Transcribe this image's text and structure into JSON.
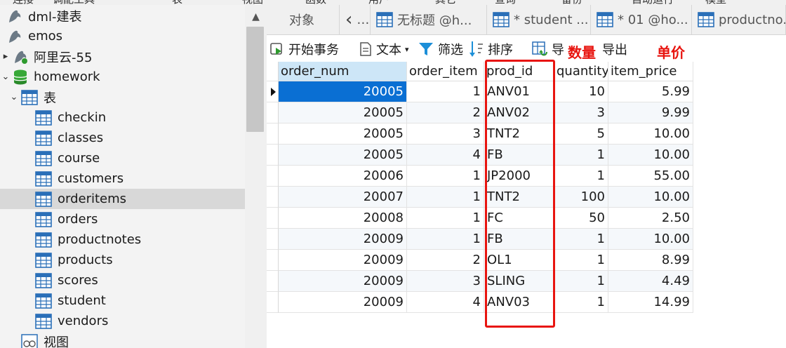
{
  "menu_fragments": [
    "连接",
    "调配工具",
    "表",
    "视图",
    "函数",
    "用户",
    "其它",
    "查询",
    "备份",
    "自动运行",
    "模型"
  ],
  "tree": [
    {
      "label": "dml-建表",
      "icon": "mysql-dolphin-icon",
      "level": 0
    },
    {
      "label": "emos",
      "icon": "mysql-dolphin-icon",
      "level": 0
    },
    {
      "label": "阿里云-55",
      "icon": "mysql-dolphin-green-icon",
      "level": 0,
      "arrow": "▸"
    },
    {
      "label": "homework",
      "icon": "database-icon",
      "level": 1,
      "arrow": "⌄"
    },
    {
      "label": "表",
      "icon": "table-icon",
      "level": 2,
      "arrow": "⌄"
    },
    {
      "label": "checkin",
      "icon": "table-icon",
      "level": 3
    },
    {
      "label": "classes",
      "icon": "table-icon",
      "level": 3
    },
    {
      "label": "course",
      "icon": "table-icon",
      "level": 3
    },
    {
      "label": "customers",
      "icon": "table-icon",
      "level": 3
    },
    {
      "label": "orderitems",
      "icon": "table-icon",
      "level": 3,
      "selected": true
    },
    {
      "label": "orders",
      "icon": "table-icon",
      "level": 3
    },
    {
      "label": "productnotes",
      "icon": "table-icon",
      "level": 3
    },
    {
      "label": "products",
      "icon": "table-icon",
      "level": 3
    },
    {
      "label": "scores",
      "icon": "table-icon",
      "level": 3
    },
    {
      "label": "student",
      "icon": "table-icon",
      "level": 3
    },
    {
      "label": "vendors",
      "icon": "table-icon",
      "level": 3
    },
    {
      "label": "视图",
      "icon": "view-icon",
      "level": 2
    }
  ],
  "tabs": [
    {
      "label": "对象",
      "icon": ""
    },
    {
      "label": "…",
      "icon": "chevron-left-icon"
    },
    {
      "label": "无标题 @h...",
      "icon": "query-icon"
    },
    {
      "label": "* student ...",
      "icon": "query-edit-icon"
    },
    {
      "label": "* 01 @ho...",
      "icon": "table-edit-icon"
    },
    {
      "label": "productno...",
      "icon": "table-icon"
    }
  ],
  "toolbar": {
    "begin_tx": "开始事务",
    "text": "文本",
    "filter": "筛选",
    "sort": "排序",
    "import": "导",
    "export": "导出"
  },
  "annotations": {
    "quantity": "数量",
    "price": "单价"
  },
  "colors": {
    "selection": "#0a6fd3",
    "annotation_red": "#e8140f",
    "sorted_header": "#cde6f7",
    "tree_selected": "#d8d8d8"
  },
  "grid": {
    "columns": [
      "order_num",
      "order_item",
      "prod_id",
      "quantity",
      "item_price"
    ],
    "rows": [
      [
        "20005",
        "1",
        "ANV01",
        "10",
        "5.99"
      ],
      [
        "20005",
        "2",
        "ANV02",
        "3",
        "9.99"
      ],
      [
        "20005",
        "3",
        "TNT2",
        "5",
        "10.00"
      ],
      [
        "20005",
        "4",
        "FB",
        "1",
        "10.00"
      ],
      [
        "20006",
        "1",
        "JP2000",
        "1",
        "55.00"
      ],
      [
        "20007",
        "1",
        "TNT2",
        "100",
        "10.00"
      ],
      [
        "20008",
        "1",
        "FC",
        "50",
        "2.50"
      ],
      [
        "20009",
        "1",
        "FB",
        "1",
        "10.00"
      ],
      [
        "20009",
        "2",
        "OL1",
        "1",
        "8.99"
      ],
      [
        "20009",
        "3",
        "SLING",
        "1",
        "4.49"
      ],
      [
        "20009",
        "4",
        "ANV03",
        "1",
        "14.99"
      ]
    ],
    "selected_row": 0
  }
}
